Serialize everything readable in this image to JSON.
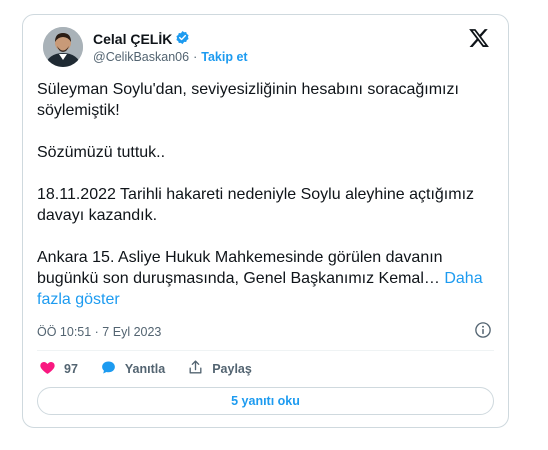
{
  "author": {
    "name": "Celal ÇELİK",
    "handle": "@CelikBaskan06",
    "separator": "·",
    "follow_label": "Takip et"
  },
  "tweet": {
    "paragraphs": [
      "Süleyman Soylu'dan, seviyesizliğinin hesabını soracağımızı söylemiştik!",
      "Sözümüzü tuttuk..",
      "18.11.2022 Tarihli hakareti nedeniyle Soylu aleyhine açtığımız davayı kazandık."
    ],
    "last_paragraph": "Ankara 15. Asliye Hukuk Mahkemesinde görülen davanın bugünkü son duruşmasında, Genel Başkanımız Kemal…",
    "show_more_label": "Daha fazla göster",
    "timestamp": "ÖÖ 10:51 · 7 Eyl 2023"
  },
  "actions": {
    "like_count": "97",
    "reply_label": "Yanıtla",
    "share_label": "Paylaş"
  },
  "read_replies_label": "5 yanıtı oku",
  "colors": {
    "accent": "#1d9bf0",
    "like": "#f91880",
    "verified": "#1d9bf0",
    "muted": "#536471"
  },
  "icons": [
    "verified-badge-icon",
    "x-logo-icon",
    "info-icon",
    "heart-icon",
    "reply-bubble-icon",
    "share-icon"
  ]
}
